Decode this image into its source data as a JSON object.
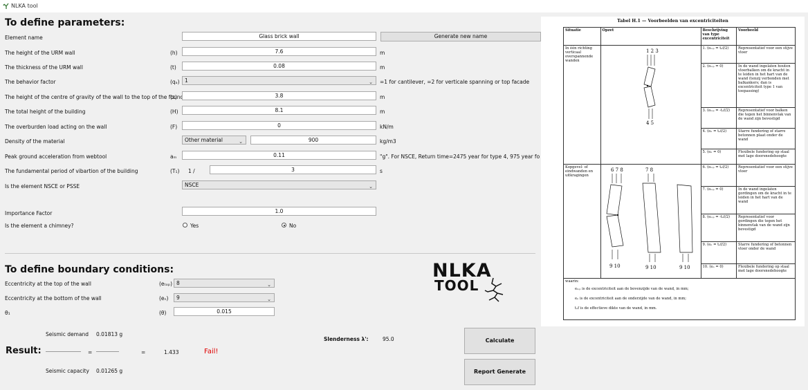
{
  "window": {
    "title": "NLKA tool"
  },
  "sections": {
    "parameters_title": "To define parameters:",
    "boundary_title": "To define boundary conditions:"
  },
  "fields": {
    "element_name": {
      "label": "Element name",
      "value": "Glass brick wall"
    },
    "generate_button": "Generate new name",
    "height": {
      "label": "The height of the URM wall",
      "symbol": "(h)",
      "value": "7.6",
      "unit": "m"
    },
    "thickness": {
      "label": "The thickness of the URM wall",
      "symbol": "(t)",
      "value": "0.08",
      "unit": "m"
    },
    "behavior": {
      "label": "The behavior factor",
      "symbol": "(qₐ)",
      "value": "1",
      "note": "=1 for cantilever, =2 for verticale spanning or top facade"
    },
    "cog_height": {
      "label": "The height of the centre of gravity of the wall to the top of the foundation",
      "symbol": "(z)",
      "value": "3.8",
      "unit": "m"
    },
    "total_height": {
      "label": "The total height of the building",
      "symbol": "(H)",
      "value": "8.1",
      "unit": "m"
    },
    "overburden": {
      "label": "The overburden load acting on the wall",
      "symbol": "(F)",
      "value": "0",
      "unit": "kN/m"
    },
    "density": {
      "label": "Density of the material",
      "material": "Other material",
      "value": "900",
      "unit": "kg/m3"
    },
    "pga": {
      "label": "Peak ground acceleration from webtool",
      "symbol": "aₘ",
      "value": "0.11",
      "note": "\"g\". For NSCE, Return time=2475 year for type 4, 975 year for type 3, 4"
    },
    "period": {
      "label": "The fundamental period of vibartion of the building",
      "symbol": "(T₁)",
      "prefix": "1 /",
      "value": "3",
      "unit": "s"
    },
    "nsce": {
      "label": "Is the element NSCE or PSSE",
      "value": "NSCE"
    },
    "importance": {
      "label": "Importance Factor",
      "value": "1.0"
    },
    "chimney": {
      "label": "Is the element a chimney?",
      "yes": "Yes",
      "no": "No",
      "selected": "No"
    },
    "ecc_top": {
      "label": "Eccentricity at the top of the wall",
      "symbol": "(eₜₒₚ)",
      "value": "8"
    },
    "ecc_bottom": {
      "label": "Eccentricity at the bottom of the wall",
      "symbol": "(eₙ)",
      "value": "9"
    },
    "theta": {
      "label": "θ₁",
      "symbol": "(θ)",
      "value": "0.015"
    }
  },
  "result": {
    "title": "Result:",
    "demand_label": "Seismic demand",
    "demand_value": "0.01813 g",
    "capacity_label": "Seismic capacity",
    "capacity_value": "0.01265 g",
    "eq1": "=",
    "eq2": "=",
    "ratio": "1.433",
    "status": "Fail!",
    "slenderness_label": "Slenderness λ':",
    "slenderness_value": "95.0"
  },
  "buttons": {
    "calculate": "Calculate",
    "report": "Report Generate"
  },
  "logo": {
    "line1": "NLKA",
    "line2": "TOOL"
  },
  "reference": {
    "title": "Tabel H.1 — Voorbeelden van excentriciteiten",
    "headers": [
      "Situatie",
      "Opzet",
      "Beschrijving van type excentriciteit",
      "Voorbeeld"
    ],
    "situation1": "In één richting verticaal overspannende wanden",
    "situation2": "Kopgevel- of eindwanden en uitkragingen",
    "rows": [
      {
        "type": "1. (eₜₒₚ = tₑf/2)",
        "example": "Representatief voor een stijve vloer"
      },
      {
        "type": "2. (eₜₒₚ = 0)",
        "example": "In de wand ingelaten houten vloerbalken om de kracht in te leiden in het hart van de wand (tenzij verbonden met balkankers; dan is excentriciteit type 1 van toepassing)"
      },
      {
        "type": "3. (eₜₒₚ = -tₑf/2)",
        "example": "Representatief voor balken die tegen het binnenvlak van de wand zijn bevestigd"
      },
      {
        "type": "4. (eₙ = tₑf/2)",
        "example": "Starre fundering of starre betonnen plaat onder de wand"
      },
      {
        "type": "5. (eₙ = 0)",
        "example": "Flexibele fundering op staal met lage doorsnedehoogte"
      },
      {
        "type": "6. (eₜₒₚ = tₑf/2)",
        "example": "Representatief voor een stijve vloer"
      },
      {
        "type": "7. (eₜₒₚ = 0)",
        "example": "In de wand ingelaten gordingen om de kracht in te leiden in het hart van de wand"
      },
      {
        "type": "8. (eₜₒₚ = -tₑf/2)",
        "example": "Representatief voor gordingen die tegen het binnenvlak van de wand zijn bevestigd"
      },
      {
        "type": "9. (eₙ = tₑf/2)",
        "example": "Starre fundering of betonnen vloer onder de wand"
      },
      {
        "type": "10. (eₙ = 0)",
        "example": "Flexibele fundering op staal met lage doorsnedehoogte"
      }
    ],
    "footnote_label": "waarin:",
    "footnotes": [
      "eₜₒₚ  is de excentriciteit aan de bovenzijde van de wand, in mm;",
      "eₙ  is de excentriciteit aan de onderzijde van de wand, in mm;",
      "tₑf  is de effectieve dikte van de wand, in mm."
    ],
    "fig_labels": {
      "a": "1 2 3",
      "b": "4 5",
      "c": "6  7  8",
      "d": "7  8",
      "e": "9 10",
      "f": "9 10",
      "g": "9 10"
    }
  },
  "colors": {
    "fail": "#e00000",
    "background": "#f0f0f0"
  }
}
